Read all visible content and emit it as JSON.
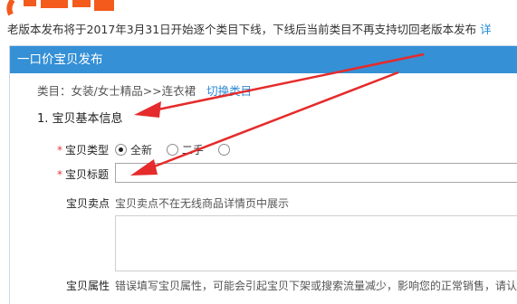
{
  "notice": {
    "text": "老版本发布将于2017年3月31日开始逐个类目下线，下线后当前类目不再支持切回老版本发布",
    "link": "详"
  },
  "panel": {
    "title": "一口价宝贝发布"
  },
  "category": {
    "text": "类目：女装/女士精品>>连衣裙",
    "switch_label": "切换类目"
  },
  "section": {
    "title": "1. 宝贝基本信息"
  },
  "fields": {
    "type": {
      "required_mark": "*",
      "label": "宝贝类型",
      "options": [
        {
          "label": "全新",
          "selected": true
        },
        {
          "label": "二手",
          "selected": false
        },
        {
          "label": "",
          "selected": false
        }
      ]
    },
    "title": {
      "required_mark": "*",
      "label": "宝贝标题",
      "value": ""
    },
    "selling_point": {
      "label": "宝贝卖点",
      "hint": "宝贝卖点不在无线商品详情页中展示",
      "value": ""
    },
    "attributes": {
      "label": "宝贝属性",
      "hint": "错误填写宝贝属性，可能会引起宝贝下架或搜索流量减少，影响您的正常销售，请认真准"
    }
  },
  "colors": {
    "header_blue": "#3590d6",
    "link_blue": "#1f8ad6",
    "required_red": "#e4393c",
    "arrow_red": "#e52b2b"
  }
}
